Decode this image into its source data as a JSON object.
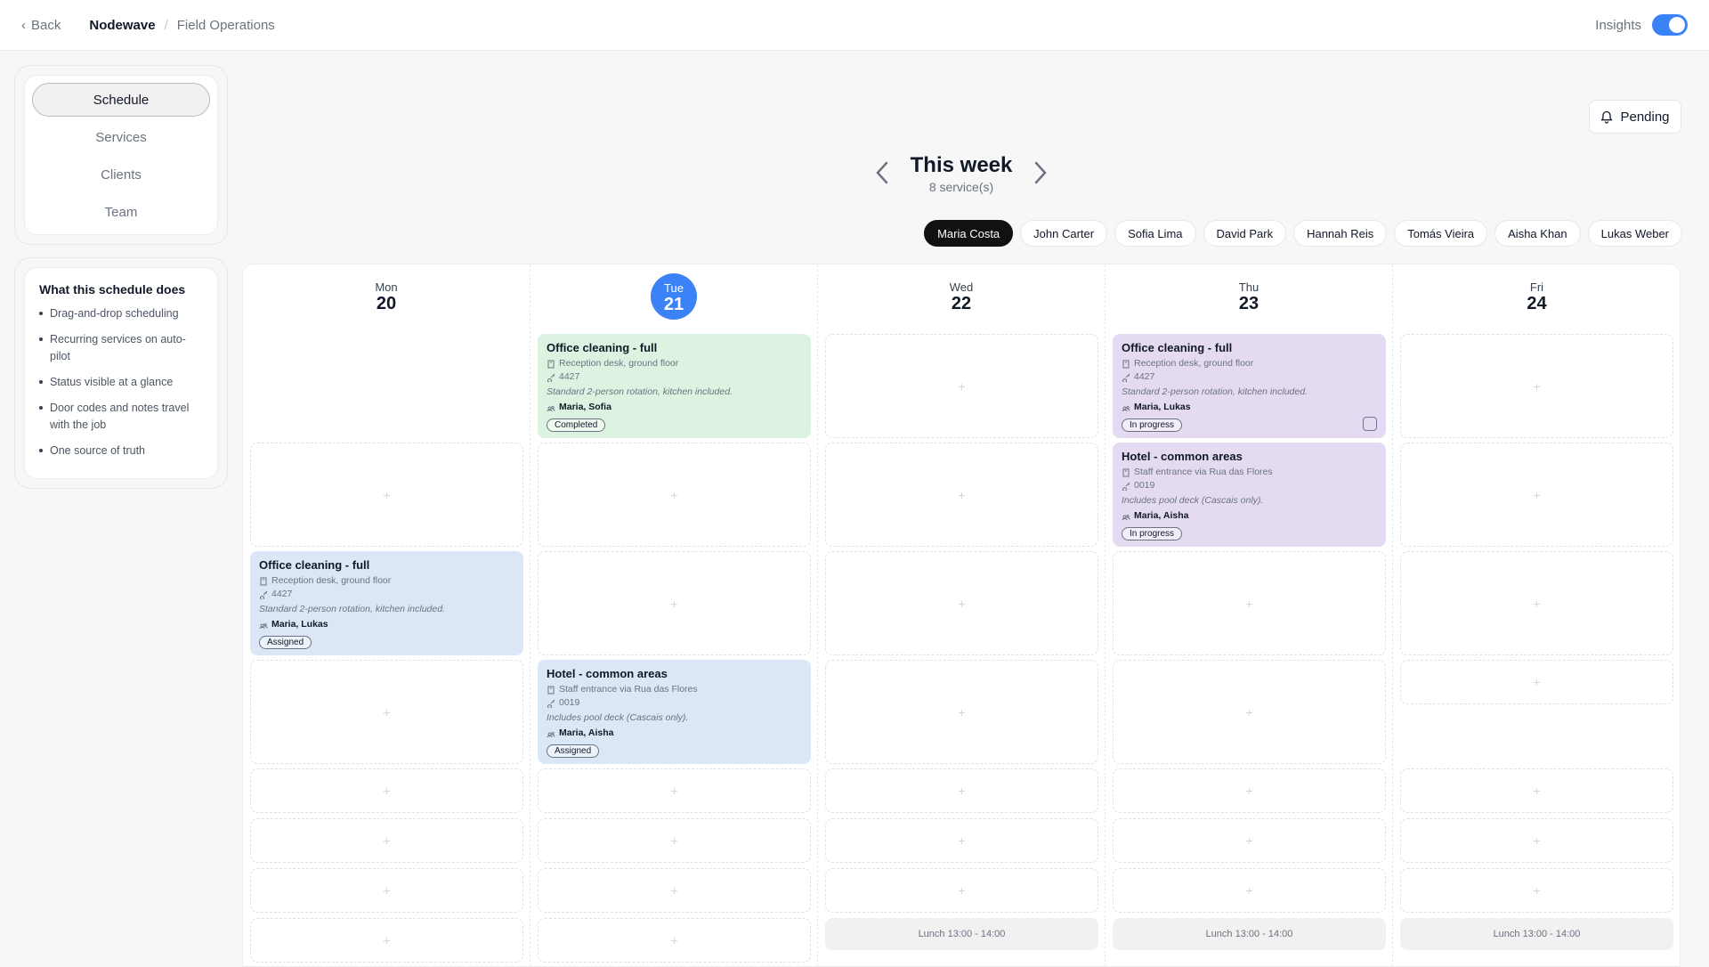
{
  "topbar": {
    "back_label": "Back",
    "brand": "Nodewave",
    "section": "Field Operations",
    "insights_label": "Insights",
    "insights_on": true
  },
  "nav": {
    "items": [
      {
        "label": "Schedule",
        "active": true
      },
      {
        "label": "Services",
        "active": false
      },
      {
        "label": "Clients",
        "active": false
      },
      {
        "label": "Team",
        "active": false
      }
    ]
  },
  "info": {
    "title": "What this schedule does",
    "items": [
      "Drag-and-drop scheduling",
      "Recurring services on auto-pilot",
      "Status visible at a glance",
      "Door codes and notes travel with the job",
      "One source of truth"
    ]
  },
  "pending_label": "Pending",
  "week": {
    "title": "This week",
    "subtitle": "8 service(s)"
  },
  "people": [
    "Maria Costa",
    "John Carter",
    "Sofia Lima",
    "David Park",
    "Hannah Reis",
    "Tomás Vieira",
    "Aisha Khan",
    "Lukas Weber"
  ],
  "days": [
    {
      "name": "Mon",
      "date": "20",
      "today": false
    },
    {
      "name": "Tue",
      "date": "21",
      "today": true
    },
    {
      "name": "Wed",
      "date": "22",
      "today": false
    },
    {
      "name": "Thu",
      "date": "23",
      "today": false
    },
    {
      "name": "Fri",
      "date": "24",
      "today": false
    }
  ],
  "lunch_label": "Lunch 13:00 - 14:00",
  "add_symbol": "+",
  "cards": [
    {
      "day": 1,
      "row": 0,
      "color": "green",
      "title": "Office cleaning - full",
      "location": "Reception desk, ground floor",
      "code": "4427",
      "note": "Standard 2-person rotation, kitchen included.",
      "workers": "Maria, Sofia",
      "status": "Completed"
    },
    {
      "day": 3,
      "row": 0,
      "color": "purple",
      "title": "Office cleaning - full",
      "location": "Reception desk, ground floor",
      "code": "4427",
      "note": "Standard 2-person rotation, kitchen included.",
      "workers": "Maria, Lukas",
      "status": "In progress"
    },
    {
      "day": 3,
      "row": 1,
      "color": "purple",
      "title": "Hotel - common areas",
      "location": "Staff entrance via Rua das Flores",
      "code": "0019",
      "note": "Includes pool deck (Cascais only).",
      "workers": "Maria, Aisha",
      "status": "In progress"
    },
    {
      "day": 0,
      "row": 2,
      "color": "blue",
      "title": "Office cleaning - full",
      "location": "Reception desk, ground floor",
      "code": "4427",
      "note": "Standard 2-person rotation, kitchen included.",
      "workers": "Maria, Lukas",
      "status": "Assigned"
    },
    {
      "day": 1,
      "row": 3,
      "color": "blue",
      "title": "Hotel - common areas",
      "location": "Staff entrance via Rua das Flores",
      "code": "0019",
      "note": "Includes pool deck (Cascais only).",
      "workers": "Maria, Aisha",
      "status": "Assigned"
    }
  ]
}
